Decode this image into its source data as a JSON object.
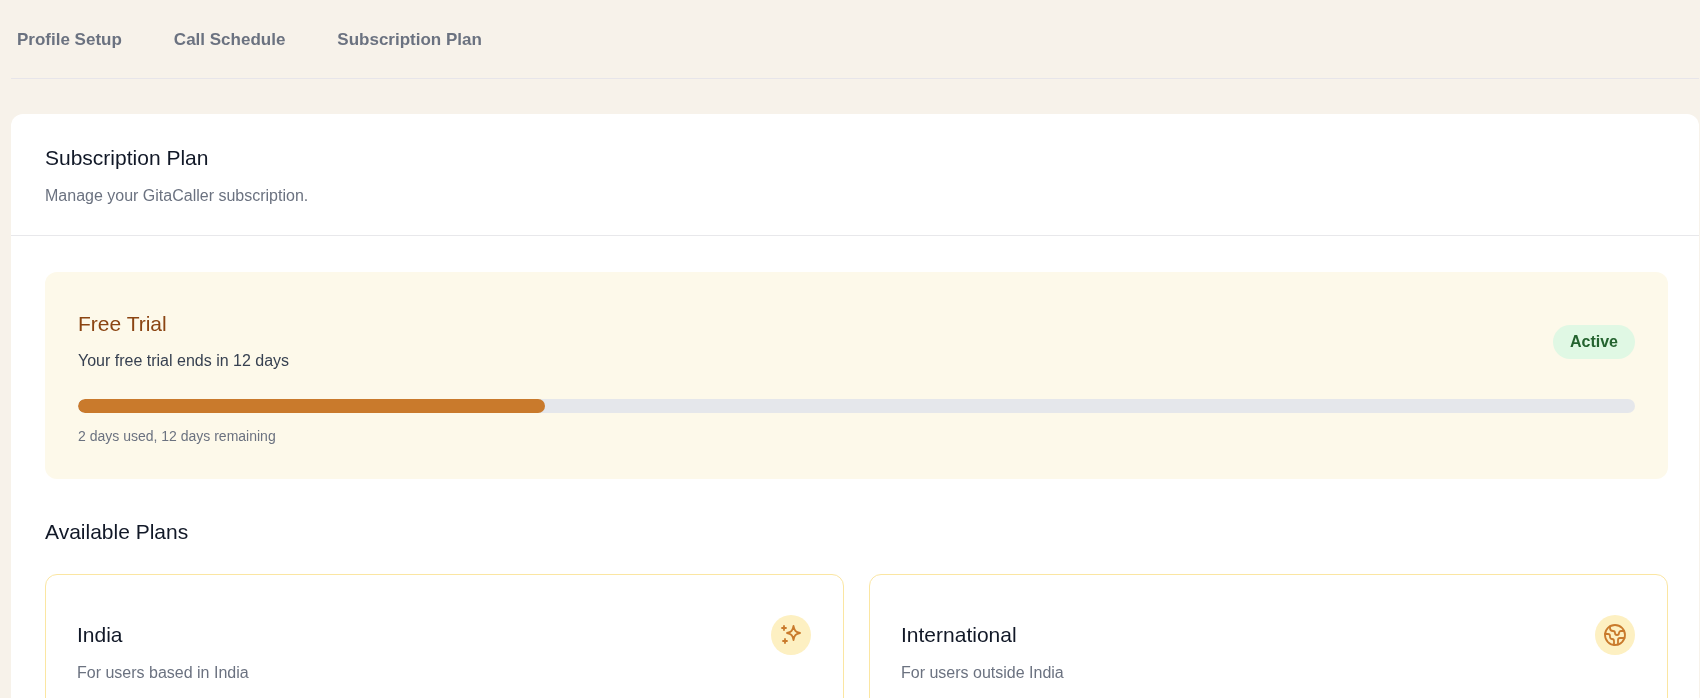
{
  "tabs": [
    {
      "label": "Profile Setup"
    },
    {
      "label": "Call Schedule"
    },
    {
      "label": "Subscription Plan"
    }
  ],
  "header": {
    "title": "Subscription Plan",
    "subtitle": "Manage your GitaCaller subscription."
  },
  "trial": {
    "title": "Free Trial",
    "message": "Your free trial ends in 12 days",
    "status": "Active",
    "progress": {
      "level": 0.3
    },
    "caption": "2 days used, 12 days remaining"
  },
  "available_plans": {
    "heading": "Available Plans",
    "plans": [
      {
        "name": "India",
        "description": "For users based in India",
        "kind": "domestic"
      },
      {
        "name": "International",
        "description": "For users outside India",
        "kind": "international"
      }
    ]
  }
}
